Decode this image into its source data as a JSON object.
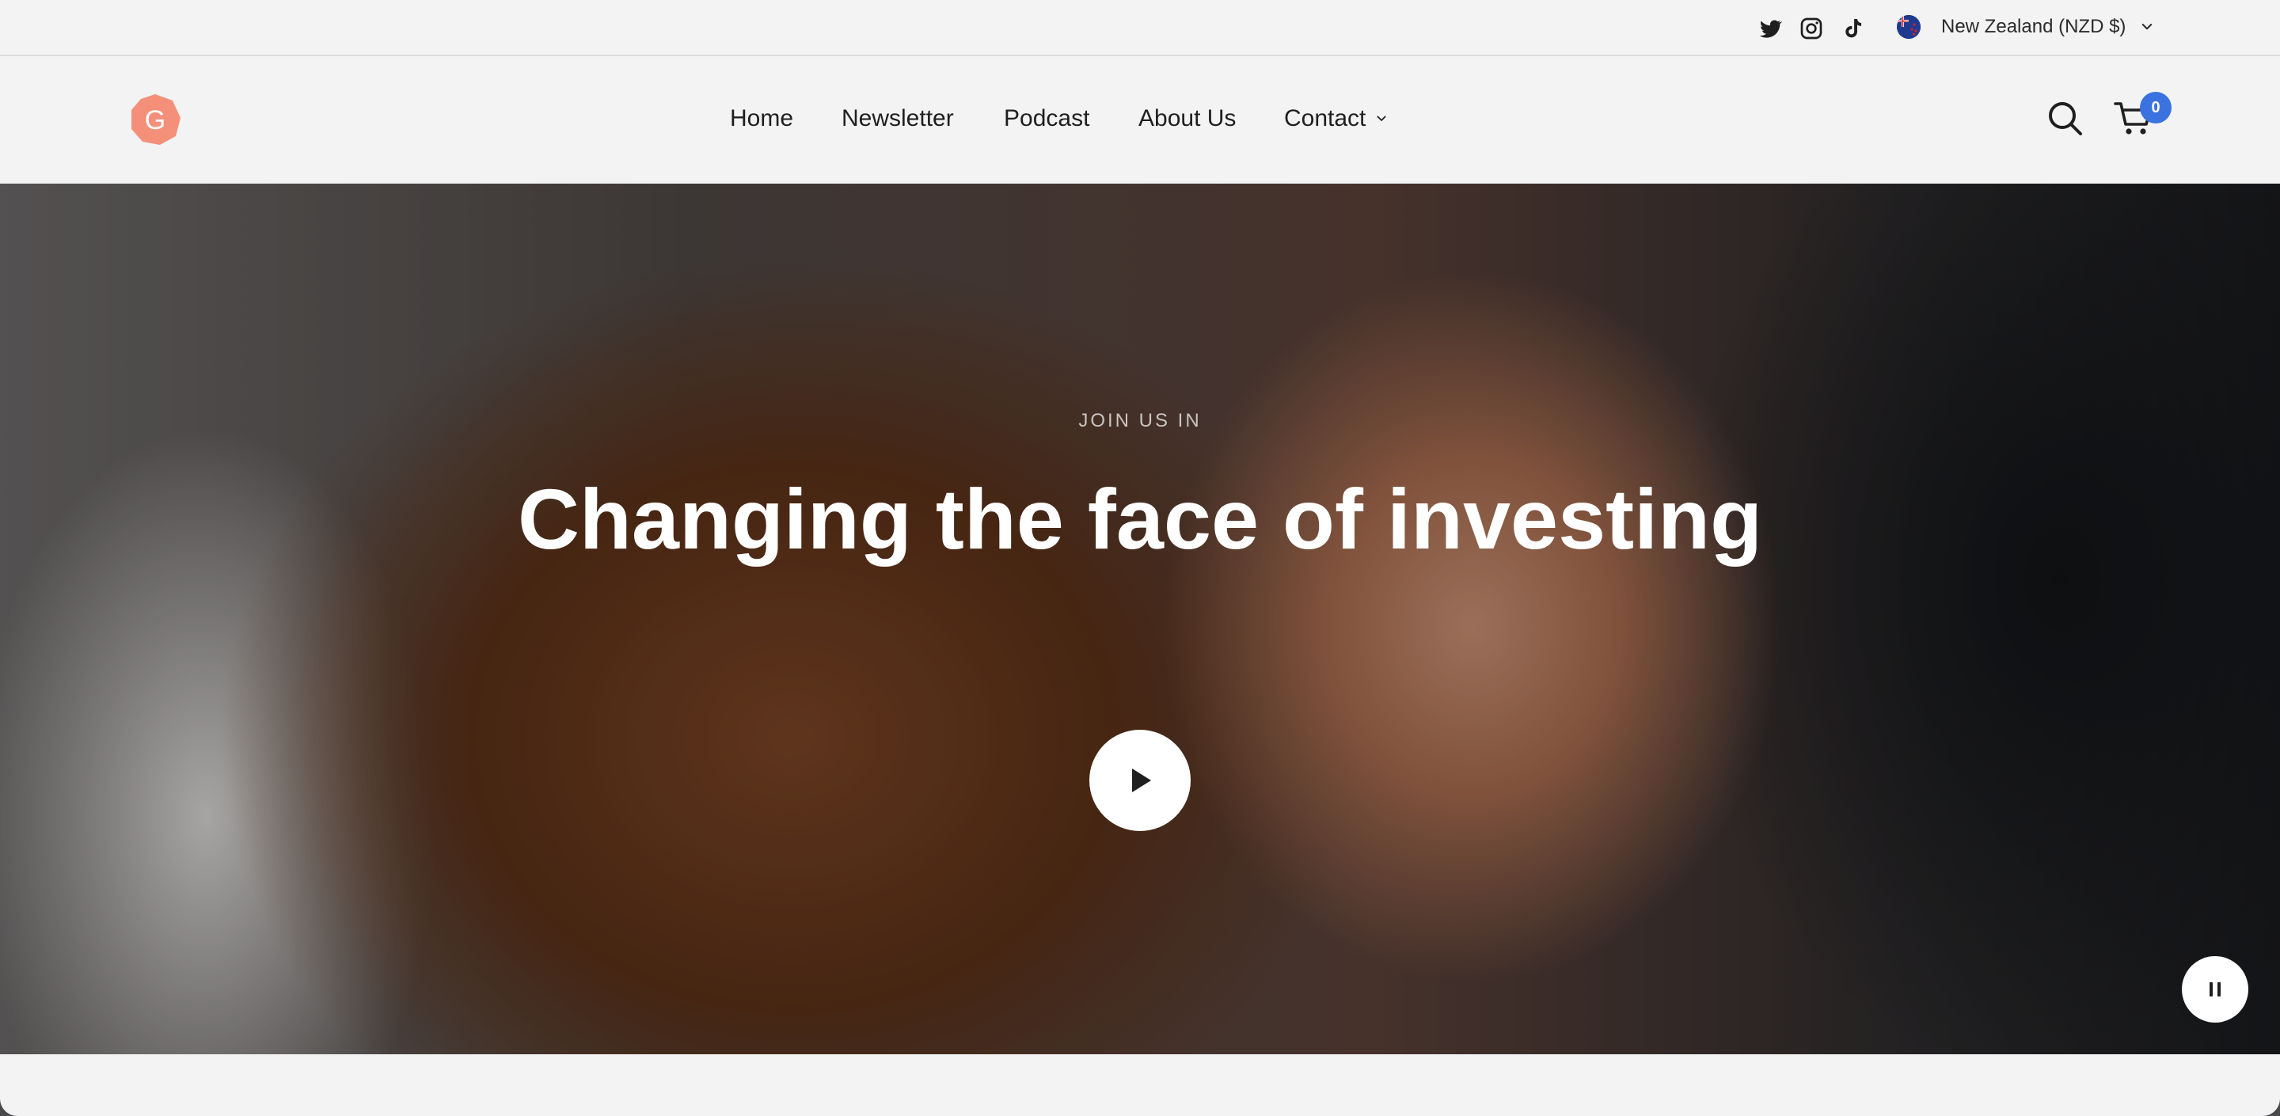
{
  "topbar": {
    "social": [
      {
        "icon": "twitter-icon"
      },
      {
        "icon": "instagram-icon"
      },
      {
        "icon": "tiktok-icon"
      }
    ],
    "currency": {
      "flag": "new-zealand-flag-icon",
      "label": "New Zealand (NZD $)"
    }
  },
  "header": {
    "logo_letter": "G",
    "nav": [
      "Home",
      "Newsletter",
      "Podcast",
      "About Us",
      "Contact"
    ],
    "cart_count": "0"
  },
  "hero": {
    "eyebrow": "JOIN US IN",
    "headline": "Changing the face of investing"
  },
  "colors": {
    "brand_logo": "#f4907a",
    "cart_badge": "#3a72e0",
    "page_bg": "#f3f3f3"
  }
}
